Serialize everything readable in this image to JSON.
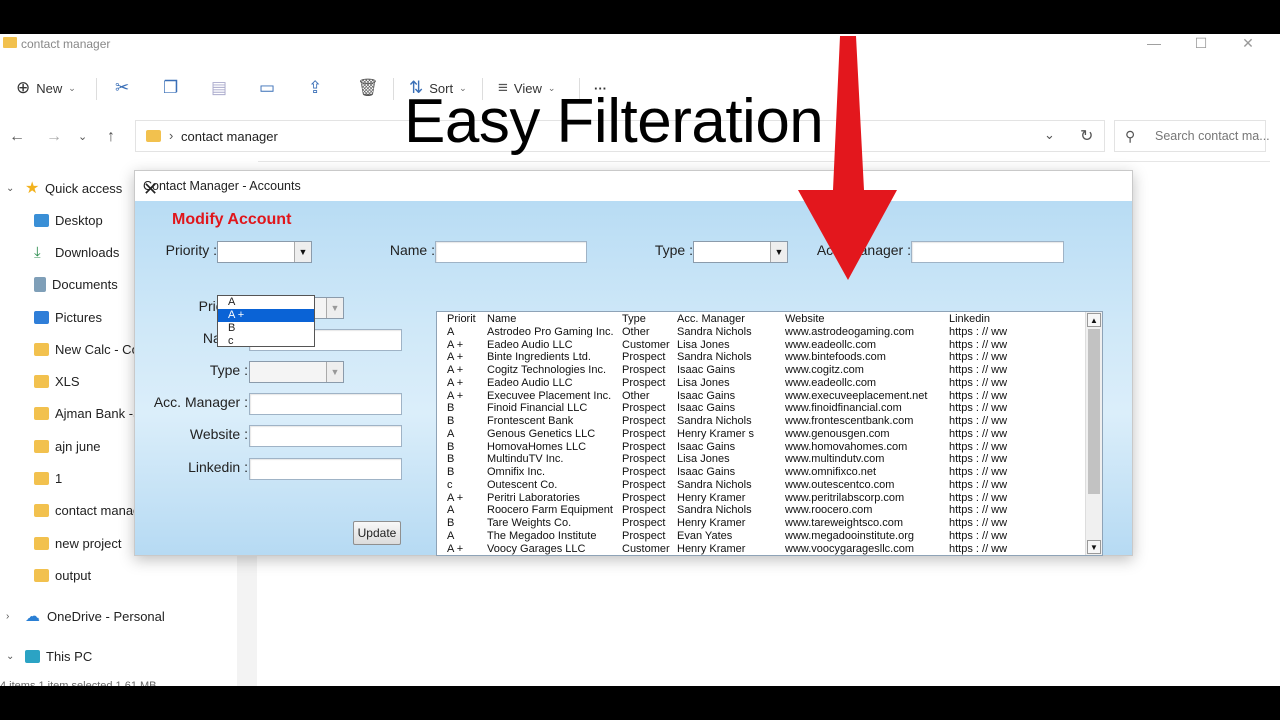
{
  "explorer": {
    "title": "contact manager",
    "toolbar": {
      "new": "New",
      "sort": "Sort",
      "view": "View",
      "more": "···"
    },
    "address": {
      "path": "contact manager",
      "search_placeholder": "Search contact ma..."
    },
    "sidebar": {
      "quick_access": "Quick access",
      "items": [
        "Desktop",
        "Downloads",
        "Documents",
        "Pictures",
        "New Calc - Cop",
        "XLS",
        "Ajman Bank -Su",
        "ajn june",
        "1",
        "contact manage",
        "new project",
        "output"
      ],
      "onedrive": "OneDrive - Personal",
      "this_pc": "This PC"
    },
    "status_text": "4 items   1 item selected   1.61 MB"
  },
  "overlay_caption": "Easy Filteration",
  "dialog": {
    "title": "Contact Manager - Accounts",
    "heading": "Modify Account",
    "filters": {
      "priority_label": "Priority :",
      "name_label": "Name :",
      "type_label": "Type :",
      "acc_manager_label": "Acc. Manager :"
    },
    "priority_options": [
      "A",
      "A +",
      "B",
      "c"
    ],
    "priority_selected_index": 1,
    "form": {
      "priority_label": "Priority :",
      "name_label": "Name :",
      "type_label": "Type :",
      "acc_manager_label": "Acc. Manager :",
      "website_label": "Website :",
      "linkedin_label": "Linkedin :",
      "update_button": "Update"
    },
    "list": {
      "columns": [
        "Priorit",
        "Name",
        "Type",
        "Acc. Manager",
        "Website",
        "Linkedin"
      ],
      "rows": [
        [
          "A",
          "Astrodeo Pro Gaming Inc.",
          "Other",
          "Sandra Nichols",
          "www.astrodeogaming.com",
          "https : // ww"
        ],
        [
          "A +",
          "Eadeo Audio LLC",
          "Customer",
          "Lisa Jones",
          "www.eadeollc.com",
          "https : // ww"
        ],
        [
          "A +",
          "Binte Ingredients Ltd.",
          "Prospect",
          "Sandra Nichols",
          "www.bintefoods.com",
          "https : // ww"
        ],
        [
          "A +",
          "Cogitz Technologies Inc.",
          "Prospect",
          "Isaac Gains",
          "www.cogitz.com",
          "https : // ww"
        ],
        [
          "A +",
          "Eadeo Audio LLC",
          "Prospect",
          "Lisa Jones",
          "www.eadeollc.com",
          "https : // ww"
        ],
        [
          "A +",
          "Execuvee Placement Inc.",
          "Other",
          "Isaac Gains",
          "www.execuveeplacement.net",
          "https : // ww"
        ],
        [
          "B",
          "Finoid Financial LLC",
          "Prospect",
          "Isaac Gains",
          "www.finoidfinancial.com",
          "https : // ww"
        ],
        [
          "B",
          "Frontescent Bank",
          "Prospect",
          "Sandra Nichols",
          "www.frontescentbank.com",
          "https : // ww"
        ],
        [
          "A",
          "Genous Genetics LLC",
          "Prospect",
          "Henry Kramer s",
          "www.genousgen.com",
          "https : // ww"
        ],
        [
          "B",
          "HomovaHomes LLC",
          "Prospect",
          "Isaac Gains",
          "www.homovahomes.com",
          "https : // ww"
        ],
        [
          "B",
          "MultinduTV Inc.",
          "Prospect",
          "Lisa Jones",
          "www.multindutv.com",
          "https : // ww"
        ],
        [
          "B",
          "Omnifix Inc.",
          "Prospect",
          "Isaac Gains",
          "www.omnifixco.net",
          "https : // ww"
        ],
        [
          "c",
          "Outescent Co.",
          "Prospect",
          "Sandra Nichols",
          "www.outescentco.com",
          "https : // ww"
        ],
        [
          "A +",
          "Peritri Laboratories",
          "Prospect",
          "Henry Kramer",
          "www.peritrilabscorp.com",
          "https : // ww"
        ],
        [
          "A",
          "Roocero Farm Equipment",
          "Prospect",
          "Sandra Nichols",
          "www.roocero.com",
          "https : // ww"
        ],
        [
          "B",
          "Tare Weights Co.",
          "Prospect",
          "Henry Kramer",
          "www.tareweightsco.com",
          "https : // ww"
        ],
        [
          "A",
          "The Megadoo Institute",
          "Prospect",
          "Evan Yates",
          "www.megadooinstitute.org",
          "https : // ww"
        ],
        [
          "A +",
          "Voocy Garages LLC",
          "Customer",
          "Henry Kramer",
          "www.voocygaragesllc.com",
          "https : // ww"
        ]
      ]
    }
  },
  "colors": {
    "heading_red": "#e0161b",
    "selection_blue": "#0a63d6",
    "arrow_red": "#e3171d"
  }
}
